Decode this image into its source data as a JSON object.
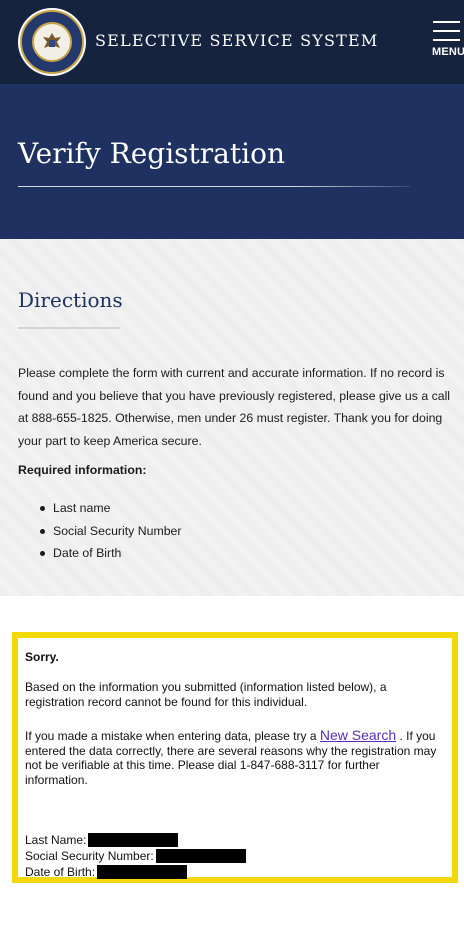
{
  "header": {
    "site_title": "SELECTIVE SERVICE SYSTEM",
    "menu_label": "MENU",
    "seal_icon": "agency-seal-icon"
  },
  "hero": {
    "title": "Verify Registration"
  },
  "directions": {
    "heading": "Directions",
    "paragraph": "Please complete the form with current and accurate information. If no record is found and you believe that you have previously registered, please give us a call at 888-655-1825. Otherwise, men under 26 must register. Thank you for doing your part to keep America secure.",
    "required_heading": "Required information:",
    "required_items": [
      "Last name",
      "Social Security Number",
      "Date of Birth"
    ]
  },
  "result": {
    "title": "Sorry.",
    "message": "Based on the information you submitted (information listed below), a registration record cannot be found for this individual.",
    "mistake_before": "If you made a mistake when entering data, please try a",
    "new_search_link": "New Search",
    "mistake_after": ". If you entered the data correctly, there are several reasons why the registration may not be verifiable at this time. Please dial 1-847-688-3117 for further information.",
    "fields": {
      "last_name_label": "Last Name:",
      "ssn_label": "Social Security Number:",
      "dob_label": "Date of Birth:"
    },
    "border_color": "#f3d90a"
  },
  "colors": {
    "header_bg": "#16233f",
    "hero_bg": "#1e3161",
    "link": "#5b2fb0"
  }
}
